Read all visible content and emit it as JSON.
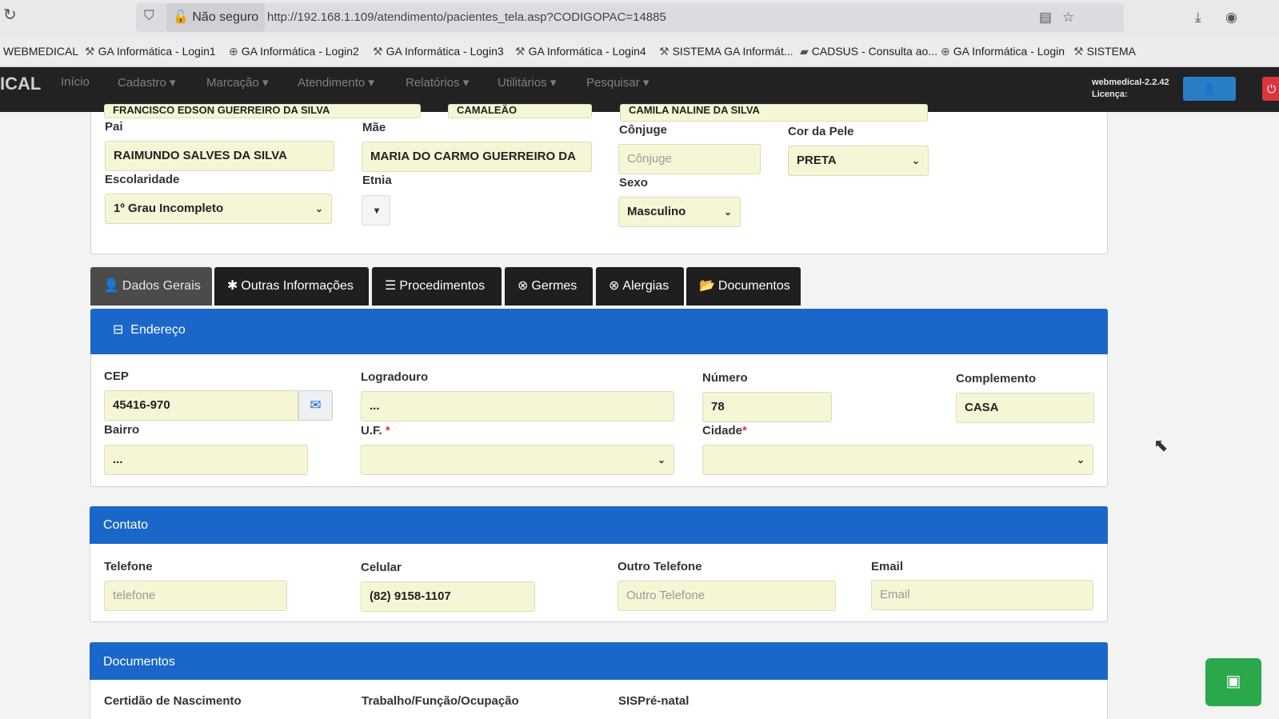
{
  "browser": {
    "security_label": "Não seguro",
    "url": "http://192.168.1.109/atendimento/pacientes_tela.asp?CODIGOPAC=14885",
    "bookmarks": [
      {
        "label": "WEBMEDICAL",
        "icon": "none"
      },
      {
        "label": "GA Informática - Login1",
        "icon": "tool-icon"
      },
      {
        "label": "GA Informática - Login2",
        "icon": "globe-icon"
      },
      {
        "label": "GA Informática - Login3",
        "icon": "tool-icon"
      },
      {
        "label": "GA Informática - Login4",
        "icon": "tool-icon"
      },
      {
        "label": "SISTEMA GA Informát...",
        "icon": "tool-icon"
      },
      {
        "label": "CADSUS - Consulta ao...",
        "icon": "card-icon"
      },
      {
        "label": "GA Informática - Login",
        "icon": "globe-icon"
      },
      {
        "label": "SISTEMA",
        "icon": "tool-icon"
      }
    ]
  },
  "navbar": {
    "brand": "ICAL",
    "items": [
      "Início",
      "Cadastro ▾",
      "Marcação ▾",
      "Atendimento ▾",
      "Relatórios ▾",
      "Utilitários ▾",
      "Pesquisar ▾"
    ],
    "version": "webmedical-2.2.42",
    "license": "Licença:"
  },
  "family": {
    "top_partial": [
      "FRANCISCO EDSON GUERREIRO DA SILVA",
      "CAMALEÃO",
      "CAMILA NALINE DA SILVA"
    ],
    "pai_label": "Pai",
    "pai": "RAIMUNDO SALVES DA SILVA",
    "mae_label": "Mãe",
    "mae": "MARIA DO CARMO GUERREIRO DA",
    "conjuge_label": "Cônjuge",
    "conjuge_placeholder": "Cônjuge",
    "cor_label": "Cor da Pele",
    "cor": "PRETA",
    "escolaridade_label": "Escolaridade",
    "escolaridade": "1º Grau Incompleto",
    "etnia_label": "Etnia",
    "sexo_label": "Sexo",
    "sexo": "Masculino"
  },
  "tabs": [
    {
      "label": "Dados Gerais",
      "icon": "user-icon",
      "glyph": "👤"
    },
    {
      "label": "Outras Informações",
      "icon": "asterisk-icon",
      "glyph": "✱"
    },
    {
      "label": "Procedimentos",
      "icon": "list-icon",
      "glyph": "☰"
    },
    {
      "label": "Germes",
      "icon": "circle-x-icon",
      "glyph": "⊗"
    },
    {
      "label": "Alergias",
      "icon": "circle-x-icon",
      "glyph": "⊗"
    },
    {
      "label": "Documentos",
      "icon": "folder-icon",
      "glyph": "📂"
    }
  ],
  "endereco": {
    "title": "Endereço",
    "cep_label": "CEP",
    "cep": "45416-970",
    "logradouro_label": "Logradouro",
    "logradouro": "...",
    "numero_label": "Número",
    "numero": "78",
    "complemento_label": "Complemento",
    "complemento": "CASA",
    "bairro_label": "Bairro",
    "bairro": "...",
    "uf_label": "U.F.",
    "cidade_label": "Cidade"
  },
  "contato": {
    "title": "Contato",
    "telefone_label": "Telefone",
    "telefone_placeholder": "telefone",
    "celular_label": "Celular",
    "celular": "(82) 9158-1107",
    "outro_label": "Outro Telefone",
    "outro_placeholder": "Outro Telefone",
    "email_label": "Email",
    "email_placeholder": "Email"
  },
  "documentos": {
    "title": "Documentos",
    "certidao_label": "Certidão de Nascimento",
    "trabalho_label": "Trabalho/Função/Ocupação",
    "sisprenatal_label": "SISPré-natal"
  },
  "colors": {
    "accent": "#1a67c9",
    "input_bg": "#f6f6d6",
    "navbar": "#222222",
    "tab_bg": "#1f1f1f"
  }
}
